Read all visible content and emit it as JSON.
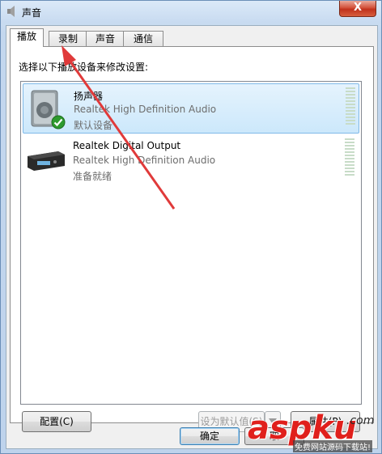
{
  "window": {
    "title": "声音",
    "close_label": "X"
  },
  "tabs": [
    {
      "label": "播放"
    },
    {
      "label": "录制"
    },
    {
      "label": "声音"
    },
    {
      "label": "通信"
    }
  ],
  "instruction": "选择以下播放设备来修改设置:",
  "devices": [
    {
      "name": "扬声器",
      "driver": "Realtek High Definition Audio",
      "status": "默认设备",
      "icon": "speaker-icon",
      "badge": "checkmark-icon"
    },
    {
      "name": "Realtek Digital Output",
      "driver": "Realtek High Definition Audio",
      "status": "准备就绪",
      "icon": "digital-output-icon"
    }
  ],
  "buttons": {
    "configure": "配置(C)",
    "set_default": "设为默认值(S)",
    "properties": "属性(P)",
    "ok": "确定",
    "cancel": "取"
  },
  "watermark": {
    "text_main": "aspku",
    "text_com": ".com",
    "text_sub": "免费网站源码下载站!"
  },
  "colors": {
    "annotation_arrow": "#e03a3a",
    "selection": "#cce8fb",
    "watermark": "#e0201c"
  }
}
